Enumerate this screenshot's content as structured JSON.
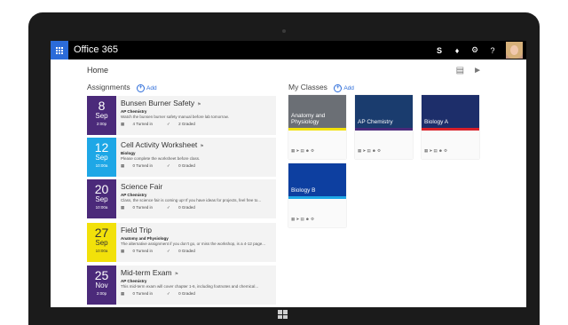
{
  "app": {
    "title": "Office 365"
  },
  "header": {
    "icons": [
      "skype-icon",
      "bell-icon",
      "gear-icon",
      "help-icon"
    ],
    "help_label": "?"
  },
  "page": {
    "title": "Home"
  },
  "assignments": {
    "heading": "Assignments",
    "add_label": "Add",
    "items": [
      {
        "day": "8",
        "month": "Sep",
        "time": "2:00p",
        "title": "Bunsen Burner Safety",
        "course": "AP Chemistry",
        "description": "Watch the bunsen burner safety manual before lab tomorrow.",
        "turned_in": "4 Turned in",
        "graded": "2 Graded",
        "color": "#4b2a7a"
      },
      {
        "day": "12",
        "month": "Sep",
        "time": "10:00a",
        "title": "Cell Activity Worksheet",
        "course": "Biology",
        "description": "Please complete the worksheet before class.",
        "turned_in": "0 Turned in",
        "graded": "0 Graded",
        "color": "#1ea7e6"
      },
      {
        "day": "20",
        "month": "Sep",
        "time": "10:00a",
        "title": "Science Fair",
        "course": "AP Chemistry",
        "description": "Class, the science fair is coming up! If you have ideas for projects, feel free to...",
        "turned_in": "0 Turned in",
        "graded": "0 Graded",
        "color": "#4b2a7a"
      },
      {
        "day": "27",
        "month": "Sep",
        "time": "10:00a",
        "title": "Field Trip",
        "course": "Anatomy and Physiology",
        "description": "The alternative assignment if you don't go, or miss the workshop, is a 4-12 page...",
        "turned_in": "0 Turned in",
        "graded": "0 Graded",
        "color": "#f2e10a"
      },
      {
        "day": "25",
        "month": "Nov",
        "time": "2:00p",
        "title": "Mid-term Exam",
        "course": "AP Chemistry",
        "description": "This mid-term exam will cover chapter 1-6, including footnotes and chemical...",
        "turned_in": "0 Turned in",
        "graded": "0 Graded",
        "color": "#4b2a7a"
      }
    ]
  },
  "classes": {
    "heading": "My Classes",
    "add_label": "Add",
    "items": [
      {
        "name": "Anatomy and Physiology",
        "stripe": "#f2e10a",
        "image": "#6b6f75"
      },
      {
        "name": "AP Chemistry",
        "stripe": "#4b2a7a",
        "image": "#1a3c6e"
      },
      {
        "name": "Biology A",
        "stripe": "#d8202a",
        "image": "#1d2e6a"
      },
      {
        "name": "Biology B",
        "stripe": "#1ea7e6",
        "image": "#0d3fa0"
      }
    ]
  }
}
